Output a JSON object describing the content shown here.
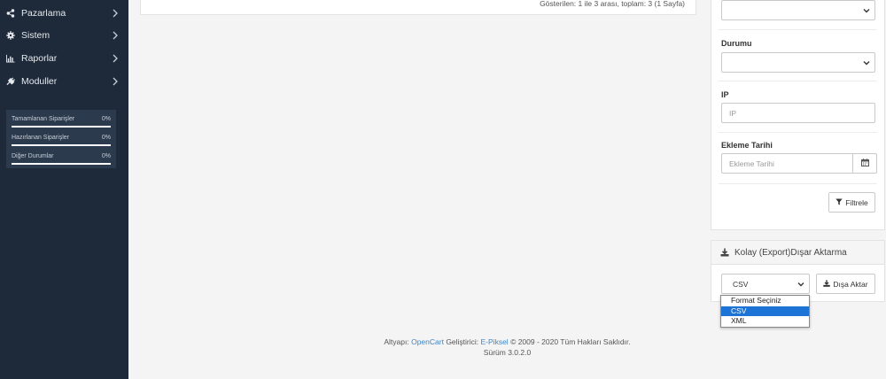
{
  "sidebar": {
    "items": [
      {
        "label": "Pazarlama",
        "icon": "share-icon"
      },
      {
        "label": "Sistem",
        "icon": "gear-icon"
      },
      {
        "label": "Raporlar",
        "icon": "bar-chart-icon"
      },
      {
        "label": "Moduller",
        "icon": "puzzle-icon"
      }
    ],
    "stats": [
      {
        "label": "Tamamlanan Siparişler",
        "value": "0%"
      },
      {
        "label": "Hazırlanan Siparişler",
        "value": "0%"
      },
      {
        "label": "Diğer Durumlar",
        "value": "0%"
      }
    ]
  },
  "list": {
    "pagination": "Gösterilen: 1 ile 3 arası, toplam: 3 (1 Sayfa)"
  },
  "filter": {
    "status_label": "Durumu",
    "ip_label": "IP",
    "ip_placeholder": "IP",
    "date_label": "Ekleme Tarihi",
    "date_placeholder": "Ekleme Tarihi",
    "filter_button": "Filtrele"
  },
  "export": {
    "title": "Kolay (Export)Dışar Aktarma",
    "selected_format": "CSV",
    "options": [
      "Format Seçiniz",
      "CSV",
      "XML"
    ],
    "button": "Dışa Aktar"
  },
  "footer": {
    "prefix": "Altyapı: ",
    "opencart": "OpenCart",
    "middle": " Geliştirici: ",
    "developer": "E-Piksel",
    "suffix": " © 2009 - 2020 Tüm Hakları Saklıdır.",
    "version": "Sürüm 3.0.2.0"
  },
  "colors": {
    "sidebar_bg": "#1e2a3a",
    "accent": "#1e74d6",
    "link": "#3d86c5"
  }
}
